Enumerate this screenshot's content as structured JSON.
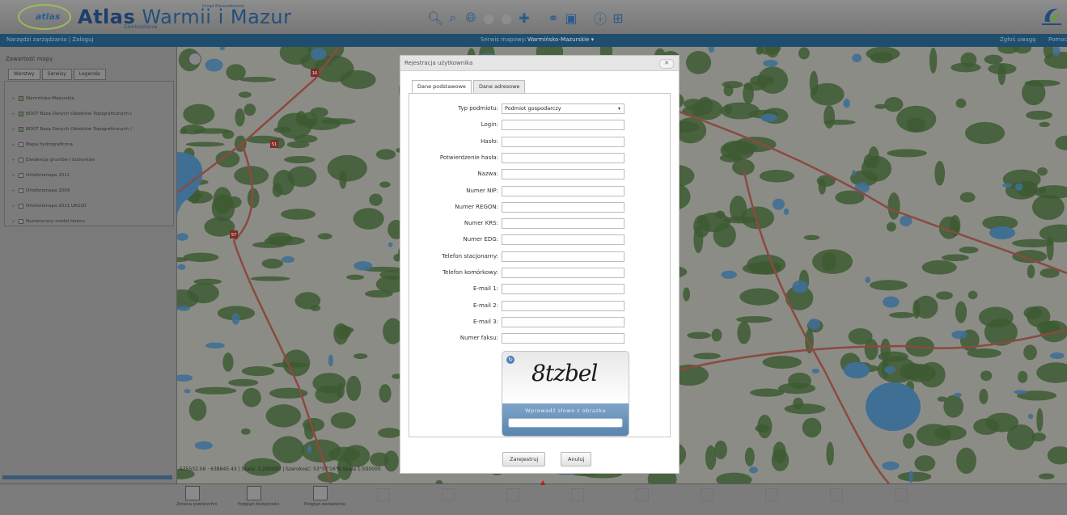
{
  "header": {
    "logo_small": "atlas",
    "title_strong": "Atlas",
    "title_rest": " Warmii i Mazur",
    "subtitle": "Zamieszkanie",
    "tagline": "Urząd Marszałkowski",
    "toolbar_icons": [
      "zoom-in-icon",
      "zoom-out-icon",
      "globe-icon",
      "zoom-prev-icon",
      "zoom-next-icon",
      "pan-icon",
      "link-icon",
      "print-icon",
      "info-icon",
      "grid-icon"
    ]
  },
  "menubar": {
    "left": "Narzędzi zarządzania | Zaloguj",
    "center_prefix": "Serwis mapowy:",
    "center_value": "Warmińsko-Mazurskie ▾",
    "right_1": "Zgłoś uwagę",
    "right_2": "Pomoc"
  },
  "left_panel": {
    "title": "Zawartość mapy",
    "tabs": [
      "Warstwy",
      "Serwisy",
      "Legenda"
    ],
    "layers": [
      {
        "label": "Warmińsko-Mazurskie",
        "checked": true
      },
      {
        "label": "BDOT Baza Danych Obiektów Topograficznych (",
        "checked": true
      },
      {
        "label": "BDOT Baza Danych Obiektów Topograficznych (",
        "checked": true
      },
      {
        "label": "Mapa hydrograficzna",
        "checked": false
      },
      {
        "label": "Ewidencja gruntów i budynków",
        "checked": false
      },
      {
        "label": "Ortofotomapa 2011",
        "checked": false
      },
      {
        "label": "Ortofotomapa 2009",
        "checked": false
      },
      {
        "label": "Ortofotomapa 2011 UR220",
        "checked": false
      },
      {
        "label": "Numeryczny model terenu",
        "checked": false
      }
    ]
  },
  "map": {
    "scale_info": "575532.06 · 638845.43  |  Skala: 1:200000  |  Szerokość: 53°57'16\"N  Skala 1:500000",
    "road_labels": [
      "16",
      "51",
      "57"
    ],
    "colors": {
      "forest": "#3f6b2c",
      "water": "#3a84c8",
      "road": "#c63b2b",
      "base": "#dcdcd0"
    }
  },
  "dialog": {
    "title": "Rejestracja użytkownika",
    "close": "✕",
    "tabs": [
      "Dane podstawowe",
      "Dane adresowe"
    ],
    "fields": [
      {
        "label": "Typ podmiotu:",
        "value": "Podmiot gospodarczy",
        "type": "select"
      },
      {
        "label": "Login:",
        "value": ""
      },
      {
        "label": "Hasło:",
        "value": ""
      },
      {
        "label": "Potwierdzenie hasła:",
        "value": ""
      },
      {
        "label": "Nazwa:",
        "value": ""
      },
      {
        "label": "Numer NIP:",
        "value": ""
      },
      {
        "label": "Numer REGON:",
        "value": ""
      },
      {
        "label": "Numer KRS:",
        "value": ""
      },
      {
        "label": "Numer EDG:",
        "value": ""
      },
      {
        "label": "Telefon stacjonarny:",
        "value": ""
      },
      {
        "label": "Telefon komórkowy:",
        "value": ""
      },
      {
        "label": "E-mail 1:",
        "value": ""
      },
      {
        "label": "E-mail 2:",
        "value": ""
      },
      {
        "label": "E-mail 3:",
        "value": ""
      },
      {
        "label": "Numer faksu:",
        "value": ""
      }
    ],
    "captcha_word": "8tzbel",
    "captcha_label": "Wprowadź słowo z obrazka",
    "buttons": {
      "submit": "Zarejestruj",
      "cancel": "Anuluj"
    }
  },
  "bottom_bar": {
    "tools": [
      {
        "label": "Zmiana powierzchni"
      },
      {
        "label": "Podgląd dostępności"
      },
      {
        "label": "Podgląd zestawienia"
      }
    ]
  }
}
